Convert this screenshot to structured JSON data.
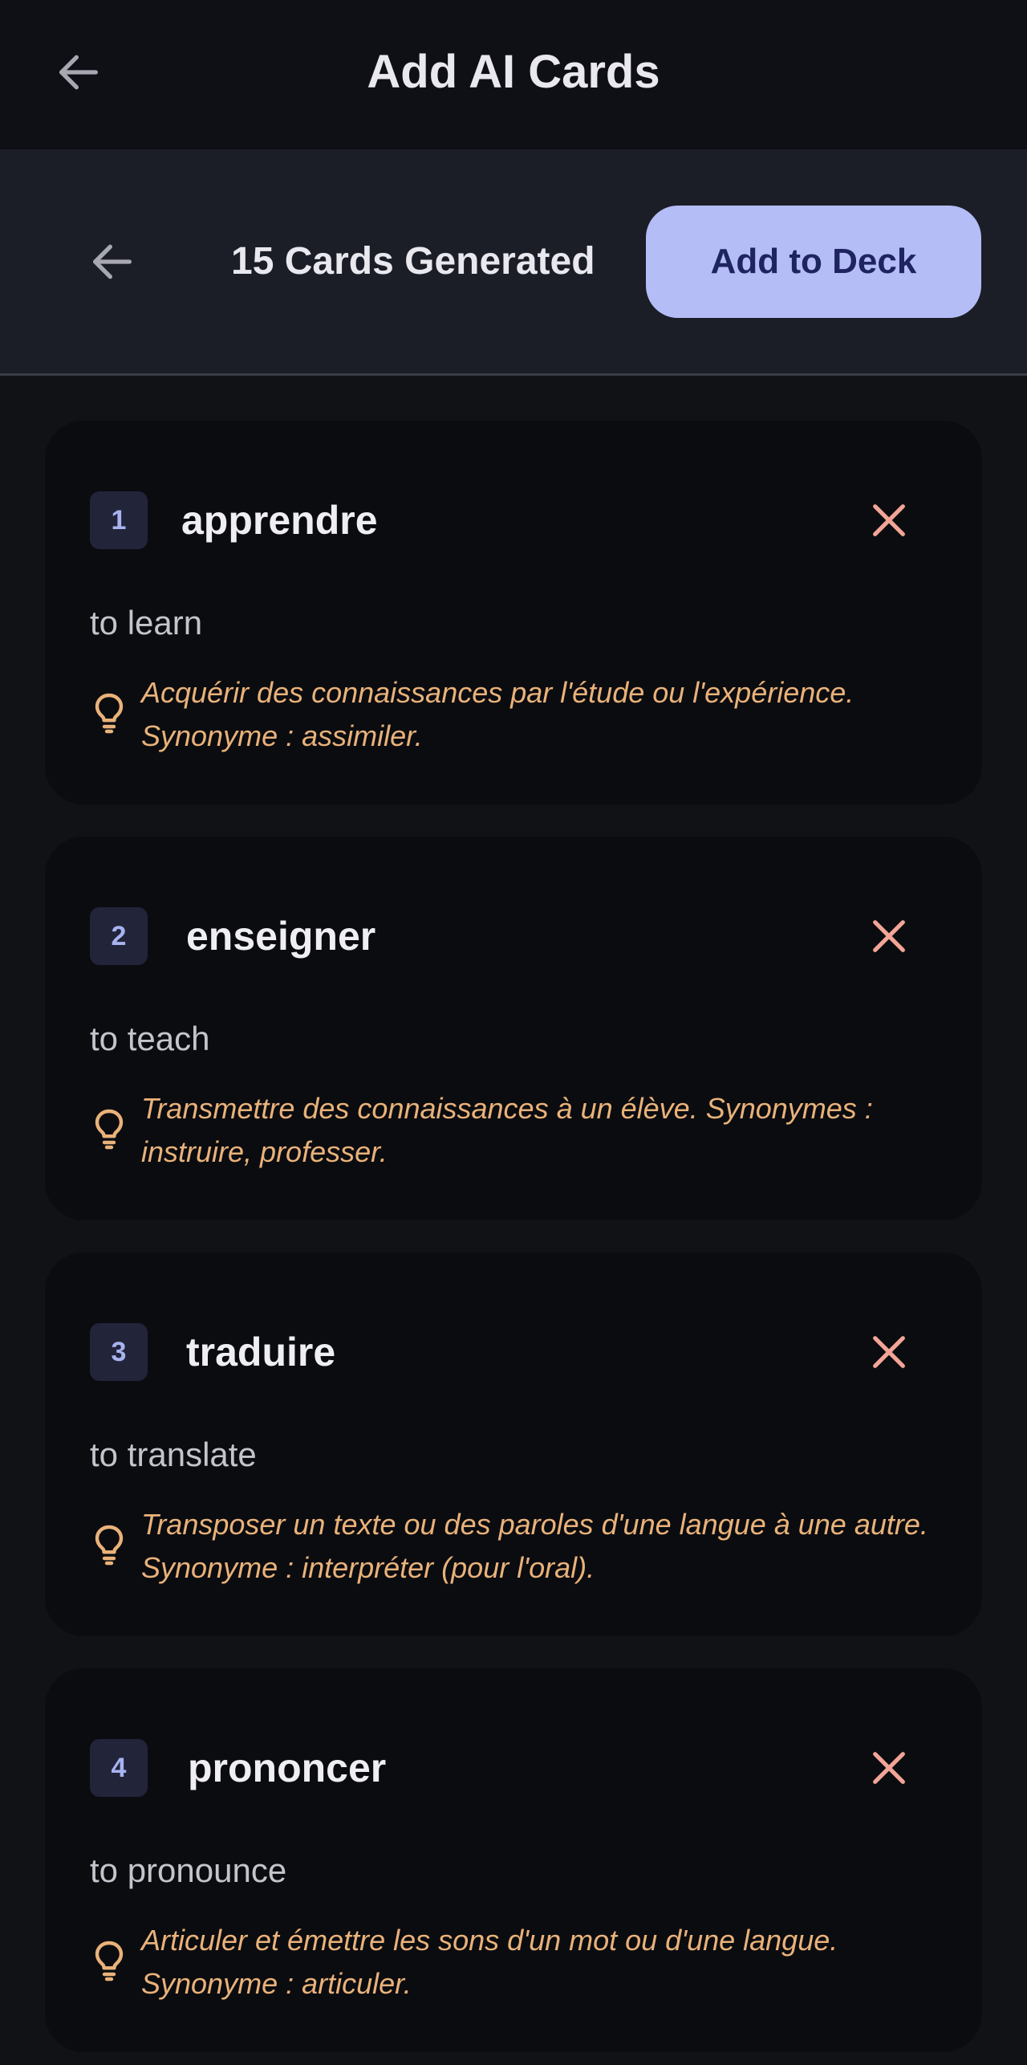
{
  "app_bar": {
    "title": "Add AI Cards",
    "back_icon": "arrow-left-icon"
  },
  "sub_header": {
    "title": "15 Cards Generated",
    "add_button_label": "Add to Deck",
    "back_icon": "arrow-left-icon"
  },
  "colors": {
    "background": "#111216",
    "card_background": "#0b0c10",
    "accent": "#b5bdf7",
    "hint_text": "#e9b27a",
    "close_icon": "#f2a596"
  },
  "cards": [
    {
      "number": "1",
      "term": "apprendre",
      "translation": "to learn",
      "hint": "Acquérir des connaissances par l'étude ou l'expérience. Synonyme : assimiler."
    },
    {
      "number": "2",
      "term": "enseigner",
      "translation": "to teach",
      "hint": "Transmettre des connaissances à un élève. Synonymes : instruire, professer."
    },
    {
      "number": "3",
      "term": "traduire",
      "translation": "to translate",
      "hint": "Transposer un texte ou des paroles d'une langue à une autre. Synonyme : interpréter (pour l'oral)."
    },
    {
      "number": "4",
      "term": "prononcer",
      "translation": "to pronounce",
      "hint": "Articuler et émettre les sons d'un mot ou d'une langue. Synonyme : articuler."
    }
  ]
}
